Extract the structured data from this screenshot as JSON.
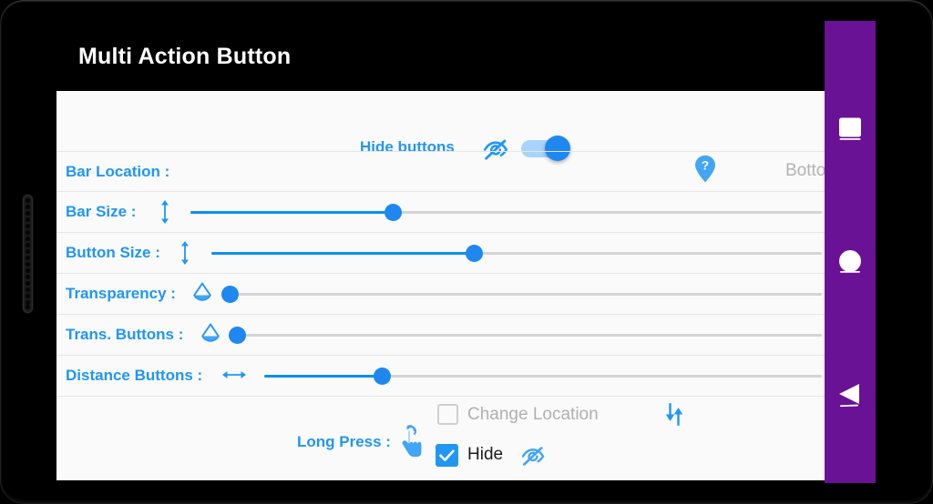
{
  "app": {
    "title": "Multi Action Button"
  },
  "nav_bar": {
    "color": "#6a1296",
    "buttons": [
      {
        "name": "recent-apps",
        "icon": "square-icon"
      },
      {
        "name": "home",
        "icon": "circle-icon"
      },
      {
        "name": "back",
        "icon": "triangle-left-icon"
      }
    ]
  },
  "settings": {
    "hide_buttons": {
      "label": "Hide buttons",
      "icon": "eye-off-icon",
      "toggle_on": true
    },
    "bar_location": {
      "label": "Bar Location :",
      "icon": "map-pin-question-icon",
      "value": "Bottom"
    },
    "bar_size": {
      "label": "Bar Size :",
      "icon": "arrows-vertical-icon",
      "percent": 32
    },
    "button_size": {
      "label": "Button Size :",
      "icon": "arrows-vertical-icon",
      "percent": 43
    },
    "transparency": {
      "label": "Transparency :",
      "icon": "water-drop-icon",
      "percent": 0
    },
    "trans_buttons": {
      "label": "Trans. Buttons :",
      "icon": "water-drop-icon",
      "percent": 0
    },
    "distance_buttons": {
      "label": "Distance Buttons :",
      "icon": "arrows-horizontal-icon",
      "percent": 21
    },
    "change_location": {
      "label": "Change Location",
      "icon": "arrow-down-up-icon",
      "checked": false
    },
    "long_press": {
      "label": "Long Press :",
      "icon": "touch-gesture-icon"
    },
    "hide": {
      "label": "Hide",
      "icon": "eye-off-icon",
      "checked": true
    }
  },
  "colors": {
    "accent_blue": "#2196f3",
    "slider_blue": "#0c8ef0",
    "nav_purple": "#6a1296",
    "muted_gray": "#b3b3b3",
    "screen_bg": "#fafafa"
  }
}
